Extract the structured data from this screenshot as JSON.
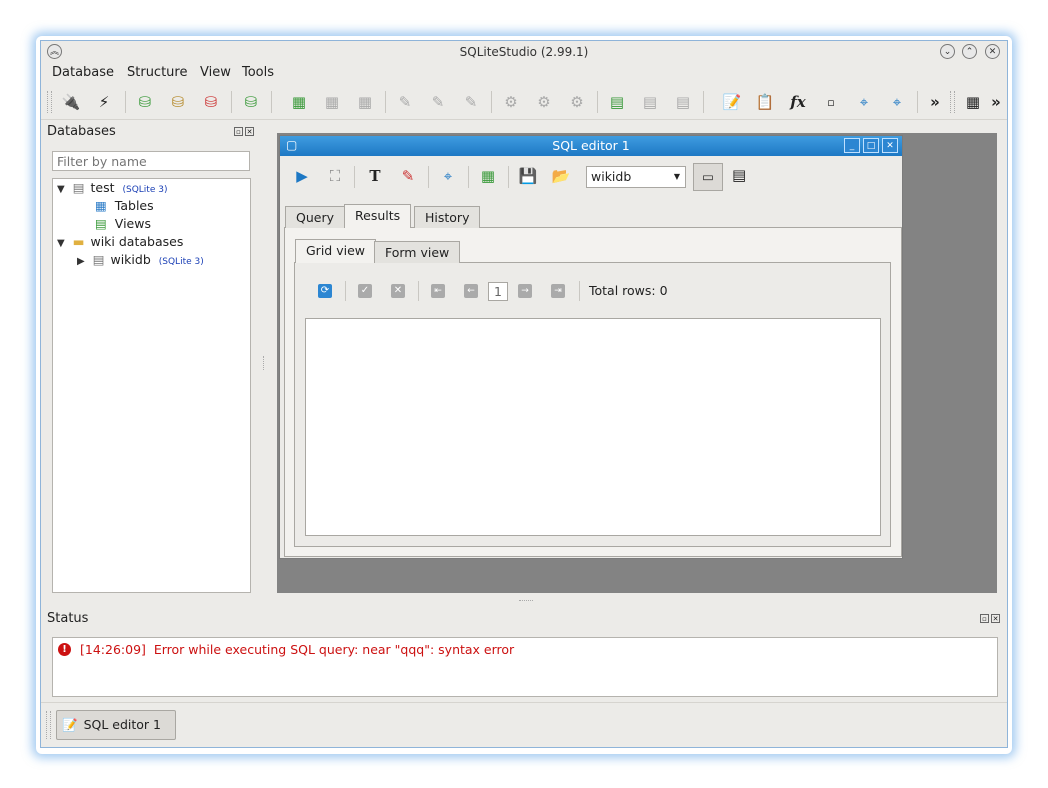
{
  "window": {
    "title": "SQLiteStudio (2.99.1)"
  },
  "menu": [
    "Database",
    "Structure",
    "View",
    "Tools"
  ],
  "databases_panel": {
    "title": "Databases",
    "filter_placeholder": "Filter by name",
    "tree": {
      "test": {
        "label": "test",
        "badge": "(SQLite 3)"
      },
      "tables": "Tables",
      "views": "Views",
      "wiki_group": "wiki databases",
      "wikidb": {
        "label": "wikidb",
        "badge": "(SQLite 3)"
      }
    }
  },
  "sql_editor": {
    "title": "SQL editor 1",
    "db_selected": "wikidb",
    "tabs": [
      "Query",
      "Results",
      "History"
    ],
    "active_tab": "Results",
    "view_tabs": [
      "Grid view",
      "Form view"
    ],
    "active_view": "Grid view",
    "page_number": "1",
    "total_rows_label": "Total rows: 0"
  },
  "status_panel": {
    "title": "Status",
    "message": "[14:26:09]  Error while executing SQL query: near \"qqq\": syntax error",
    "message_color": "#cc1111"
  },
  "taskbar": {
    "item": "SQL editor 1"
  },
  "toolbar": {
    "overflow": "»"
  },
  "colors": {
    "accent": "#1d78c4",
    "error": "#cc1111",
    "badge": "#1a3fb5"
  }
}
